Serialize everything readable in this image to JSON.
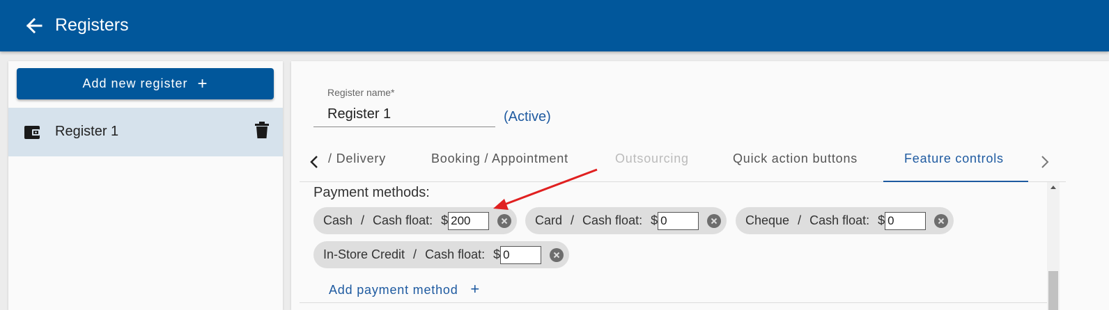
{
  "header": {
    "title": "Registers",
    "back_icon": "arrow-left-icon"
  },
  "sidebar": {
    "add_button_label": "Add new register",
    "add_button_icon": "+",
    "registers": [
      {
        "label": "Register 1",
        "icon": "wallet-icon",
        "selected": true
      }
    ]
  },
  "register_form": {
    "name_label": "Register name*",
    "name_value": "Register 1",
    "status": "(Active)"
  },
  "tabs": {
    "items": [
      {
        "label": "/ Delivery",
        "state": "partial"
      },
      {
        "label": "Booking / Appointment",
        "state": "normal"
      },
      {
        "label": "Outsourcing",
        "state": "disabled"
      },
      {
        "label": "Quick action buttons",
        "state": "normal"
      },
      {
        "label": "Feature controls",
        "state": "active"
      }
    ]
  },
  "payment": {
    "title": "Payment methods:",
    "float_label": "Cash float:",
    "separator": "/",
    "currency": "$",
    "methods": [
      {
        "name": "Cash",
        "float": "200"
      },
      {
        "name": "Card",
        "float": "0"
      },
      {
        "name": "Cheque",
        "float": "0"
      },
      {
        "name": "In-Store Credit",
        "float": "0"
      }
    ],
    "add_label": "Add payment method",
    "add_icon": "+"
  },
  "colors": {
    "primary": "#01579b",
    "accent_text": "#1e5aa0",
    "selected_bg": "#d6e2ec",
    "chip_bg": "#dedede",
    "annotation_arrow": "#e02020"
  }
}
